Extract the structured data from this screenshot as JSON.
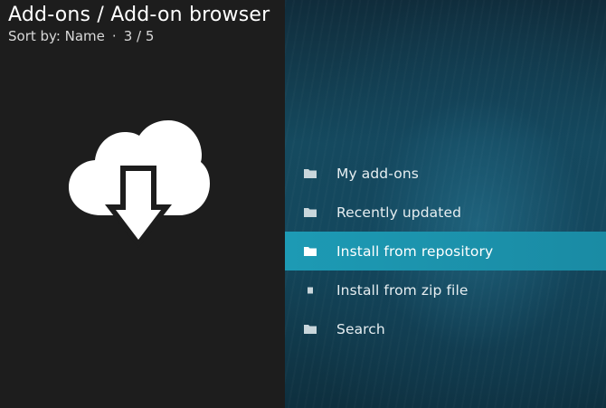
{
  "header": {
    "breadcrumb": "Add-ons / Add-on browser",
    "sort_label": "Sort by: Name",
    "separator": "·",
    "position": "3 / 5"
  },
  "hero": {
    "icon": "cloud-download-icon"
  },
  "menu": {
    "items": [
      {
        "label": "My add-ons",
        "icon": "folder-icon",
        "selected": false
      },
      {
        "label": "Recently updated",
        "icon": "folder-icon",
        "selected": false
      },
      {
        "label": "Install from repository",
        "icon": "folder-icon",
        "selected": true
      },
      {
        "label": "Install from zip file",
        "icon": "file-icon",
        "selected": false
      },
      {
        "label": "Search",
        "icon": "folder-icon",
        "selected": false
      }
    ]
  },
  "colors": {
    "selected_bg": "#1d9ab4",
    "left_panel_bg": "#1d1d1d",
    "right_panel_bg": "#154a5f"
  }
}
